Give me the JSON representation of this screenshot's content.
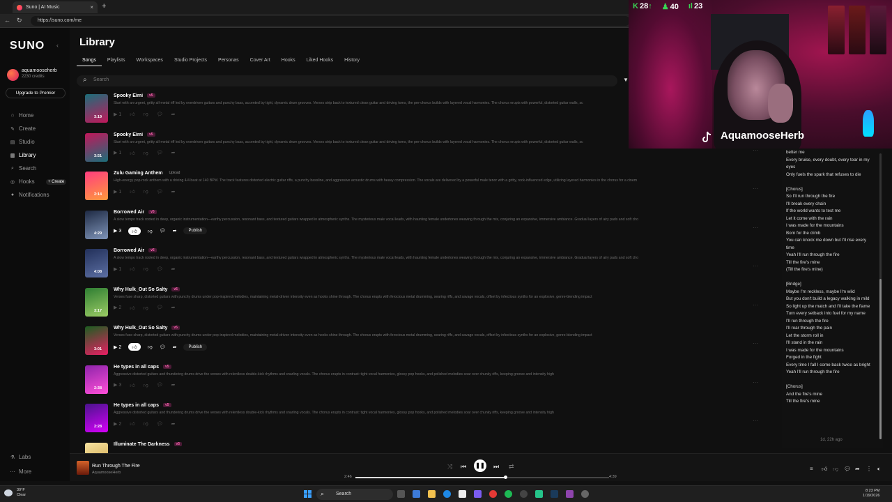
{
  "browser": {
    "tab_title": "Suno | AI Music",
    "tab_close": "×",
    "new_tab": "+",
    "url": "https://suno.com/me"
  },
  "sidebar": {
    "logo": "SUNO",
    "username": "aquamooseherb",
    "credits": "2230 credits",
    "upgrade": "Upgrade to Premier",
    "nav": [
      "Home",
      "Create",
      "Studio",
      "Library",
      "Search",
      "Hooks",
      "Notifications"
    ],
    "create_pill": "+ Create",
    "bottom": [
      "Labs",
      "More"
    ]
  },
  "main": {
    "title": "Library",
    "tabs": [
      "Songs",
      "Playlists",
      "Workspaces",
      "Studio Projects",
      "Personas",
      "Cover Art",
      "Hooks",
      "Liked Hooks",
      "History"
    ],
    "search_placeholder": "Search"
  },
  "songs": [
    {
      "title": "Spooky Eimi",
      "badge": "v5",
      "duration": "3:19",
      "plays": "1",
      "desc": "Start with an urgent, gritty all-metal riff led by overdriven guitars and punchy bass, accented by tight, dynamic drum grooves. Verses strip back to textured clean guitar and driving toms, the pre-chorus builds with layered vocal harmonies. The chorus erupts with powerful, distorted guitar walls, sc",
      "colors": [
        "#1b6f7a",
        "#c2185b"
      ]
    },
    {
      "title": "Spooky Eimi",
      "badge": "v5",
      "duration": "3:51",
      "plays": "1",
      "desc": "Start with an urgent, gritty all-metal riff led by overdriven guitars and punchy bass, accented by tight, dynamic drum grooves. Verses strip back to textured clean guitar and driving toms, the pre-chorus builds with layered vocal harmonies. The chorus erupts with powerful, distorted guitar walls, sc",
      "colors": [
        "#c2185b",
        "#1b6f7a"
      ]
    },
    {
      "title": "Zulu Gaming Anthem",
      "badge": "Upload",
      "duration": "2:14",
      "plays": "1",
      "desc": "High-energy pop-rock anthem with a driving 4/4 beat at 140 BPM. The track features distorted electric guitar riffs, a punchy bassline, and aggressive acoustic drums with heavy compression. The vocals are delivered by a powerful male tenor with a gritty, rock-influenced edge, utilizing layered harmonies in the chorus for a cinem",
      "colors": [
        "#ff3d7f",
        "#ff9a3c"
      ]
    },
    {
      "title": "Borrowed Air",
      "badge": "v5",
      "duration": "4:29",
      "plays": "3",
      "desc": "A slow tempo track rooted in deep, organic instrumentation—earthy percussion, resonant bass, and textured guitars wrapped in atmospheric synths. The mysterious male vocal leads, with haunting female undertones weaving through the mix, conjuring an expansive, immersive ambiance. Gradual layers of airy pads and soft cho",
      "colors": [
        "#1e2a44",
        "#7f94b8"
      ],
      "hi": true,
      "publish": "Publish"
    },
    {
      "title": "Borrowed Air",
      "badge": "v5",
      "duration": "4:08",
      "plays": "1",
      "desc": "A slow tempo track rooted in deep, organic instrumentation—earthy percussion, resonant bass, and textured guitars wrapped in atmospheric synths. The mysterious male vocal leads, with haunting female undertones weaving through the mix, conjuring an expansive, immersive ambiance. Gradual layers of airy pads and soft cho",
      "colors": [
        "#22305a",
        "#5c6fa3"
      ]
    },
    {
      "title": "Why Hulk_Out So Salty",
      "badge": "v5",
      "duration": "3:17",
      "plays": "2",
      "desc": "Verses fuse sharp, distorted guitars with punchy drums under pop-inspired melodies, maintaining metal-driven intensity even as hooks shine through. The chorus erupts with ferocious metal drumming, searing riffs, and savage vocals, offset by infectious synths for an explosive, genre-blending impact",
      "colors": [
        "#2e7d32",
        "#9ccc65"
      ]
    },
    {
      "title": "Why Hulk_Out So Salty",
      "badge": "v5",
      "duration": "3:01",
      "plays": "2",
      "desc": "Verses fuse sharp, distorted guitars with punchy drums under pop-inspired melodies, maintaining metal-driven intensity even as hooks shine through. The chorus erupts with ferocious metal drumming, searing riffs, and savage vocals, offset by infectious synths for an explosive, genre-blending impact",
      "colors": [
        "#1b5e20",
        "#e91e63"
      ],
      "hi": true,
      "publish": "Publish"
    },
    {
      "title": "He types in all caps",
      "badge": "v5",
      "duration": "2:38",
      "plays": "3",
      "desc": "Aggressive distorted guitars and thundering drums drive the verses with relentless double-kick rhythms and snarling vocals. The chorus erupts in contrast: tight vocal harmonies, glossy pop hooks, and polished melodies soar over chunky riffs, keeping groove and intensity high",
      "colors": [
        "#8e24aa",
        "#ff4fd8"
      ]
    },
    {
      "title": "He types in all caps",
      "badge": "v5",
      "duration": "2:28",
      "plays": "2",
      "desc": "Aggressive distorted guitars and thundering drums drive the verses with relentless double-kick rhythms and snarling vocals. The chorus erupts in contrast: tight vocal harmonies, glossy pop hooks, and polished melodies soar over chunky riffs, keeping groove and intensity high",
      "colors": [
        "#4a148c",
        "#d500f9"
      ]
    },
    {
      "title": "Illuminate The Darkness",
      "badge": "v5",
      "duration": "",
      "plays": "",
      "desc": "",
      "colors": [
        "#f6e3a1",
        "#c89b3c"
      ]
    }
  ],
  "lyrics": {
    "text": "better me\nEvery bruise, every doubt, every tear in my eyes\nOnly fuels the spark that refuses to die\n\n[Chorus]\nSo I'll run through the fire\nI'll break every chain\nIf the world wants to test me\nLet it come with the rain\nI was made for the mountains\nBorn for the climb\nYou can knock me down but I'll rise every time\nYeah I'll run through the fire\nTill the fire's mine\n(Till the fire's mine)\n\n[Bridge]\nMaybe I'm reckless, maybe I'm wild\nBut you don't build a legacy walking in mild\nSo light up the match and I'll take the flame\nTurn every setback into fuel for my name\nI'll run through the fire\nI'll roar through the pain\nLet the storm roll in\nI'll stand in the rain\nI was made for the mountains\nForged in the fight\nEvery time I fall I come back twice as bright\nYeah I'll run through the fire\n\n[Chorus]\nAnd the fire's mine\nTill the fire's mine",
    "time": "1d, 22h ago"
  },
  "webcam": {
    "stat1": "28",
    "stat2": "40",
    "stat3": "23",
    "name": "AquamooseHerb"
  },
  "player": {
    "title": "Run Through The Fire",
    "artist": "AquamooseHerb",
    "elapsed": "2:46",
    "total": "4:39",
    "progress": 0.59
  },
  "taskbar": {
    "temp": "30°F",
    "weather": "Clear",
    "search": "Search",
    "time": "8:23 PM",
    "date": "1/19/2026"
  }
}
